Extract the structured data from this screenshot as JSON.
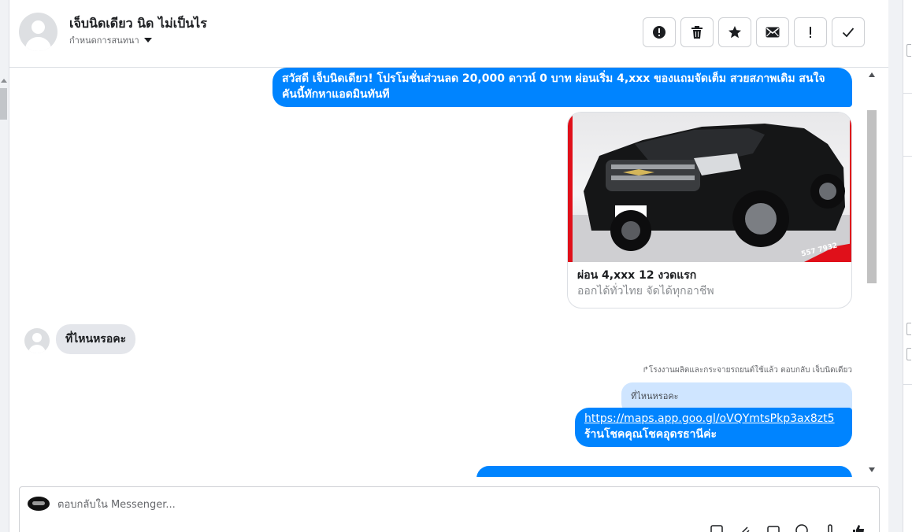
{
  "header": {
    "contact_name": "เจ็บนิดเดียว นิด ไม่เป็นไร",
    "assign_label": "กำหนดการสนทนา"
  },
  "actions": [
    {
      "name": "report-icon"
    },
    {
      "name": "trash-icon"
    },
    {
      "name": "star-icon"
    },
    {
      "name": "envelope-icon"
    },
    {
      "name": "exclamation-icon"
    },
    {
      "name": "checkmark-icon"
    }
  ],
  "messages": {
    "outgoing_1_line1": "สวัสดี เจ็บนิดเดียว! โปรโมชั่นส่วนลด 20,000 ดาวน์ 0 บาท ผ่อนเริ่ม 4,xxx  ของแถมจัดเต็ม สวยสภาพเดิม สนใจ",
    "outgoing_1_line2": "คันนี้ทักหาแอดมินทันที",
    "card": {
      "title": "ผ่อน 4,xxx 12 งวดแรก",
      "subtitle": "ออกได้ทั่วไทย จัดได้ทุกอาชีพ",
      "phone_overlay": "557 7932"
    },
    "incoming_1": "ที่ไหนหรอคะ",
    "reply_meta": "↱โรงงานผลิตและกระจายรถยนต์ใช้แล้ว ตอบกลับ เจ็บนิดเดียว",
    "quoted_text": "ที่ไหนหรอคะ",
    "outgoing_2_link": "https://maps.app.goo.gl/oVQYmtsPkp3ax8zt5",
    "outgoing_2_text": "ร้านโชคคุณโชคอุดรธานีค่ะ"
  },
  "composer": {
    "placeholder": "ตอบกลับใน Messenger..."
  },
  "colors": {
    "accent": "#0084ff",
    "incoming_bubble": "#e4e6eb",
    "quoted_bubble": "#cfe5ff"
  }
}
